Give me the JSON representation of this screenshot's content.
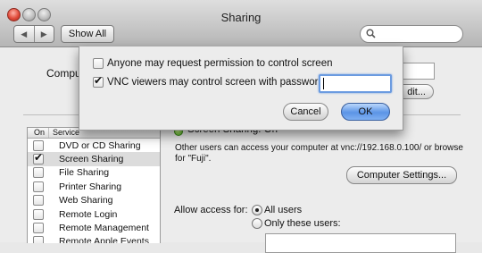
{
  "window": {
    "title": "Sharing"
  },
  "toolbar": {
    "back_icon": "back-arrow-icon",
    "forward_icon": "forward-arrow-icon",
    "show_all_label": "Show All",
    "search_icon": "magnifier-icon",
    "search_value": ""
  },
  "computer_name": {
    "label": "Comput",
    "value": ""
  },
  "edit_button": {
    "label": "dit..."
  },
  "services": {
    "header_on": "On",
    "header_service": "Service",
    "items": [
      {
        "name": "DVD or CD Sharing",
        "checked": false,
        "selected": false
      },
      {
        "name": "Screen Sharing",
        "checked": true,
        "selected": true
      },
      {
        "name": "File Sharing",
        "checked": false,
        "selected": false
      },
      {
        "name": "Printer Sharing",
        "checked": false,
        "selected": false
      },
      {
        "name": "Web Sharing",
        "checked": false,
        "selected": false
      },
      {
        "name": "Remote Login",
        "checked": false,
        "selected": false
      },
      {
        "name": "Remote Management",
        "checked": false,
        "selected": false
      },
      {
        "name": "Remote Apple Events",
        "checked": false,
        "selected": false
      }
    ]
  },
  "detail": {
    "status": "Screen Sharing: On",
    "status_color": "#4caf1e",
    "description": "Other users can access your computer at vnc://192.168.0.100/ or browse for \"Fuji\".",
    "computer_settings_label": "Computer Settings...",
    "allow_access_label": "Allow access for:",
    "all_users_label": "All users",
    "only_these_users_label": "Only these users:",
    "selected_access": "All users"
  },
  "sheet": {
    "request_permission_label": "Anyone may request permission to control screen",
    "request_permission_checked": false,
    "vnc_password_label": "VNC viewers may control screen with password:",
    "vnc_password_checked": true,
    "password_value": "",
    "cancel_label": "Cancel",
    "ok_label": "OK"
  }
}
